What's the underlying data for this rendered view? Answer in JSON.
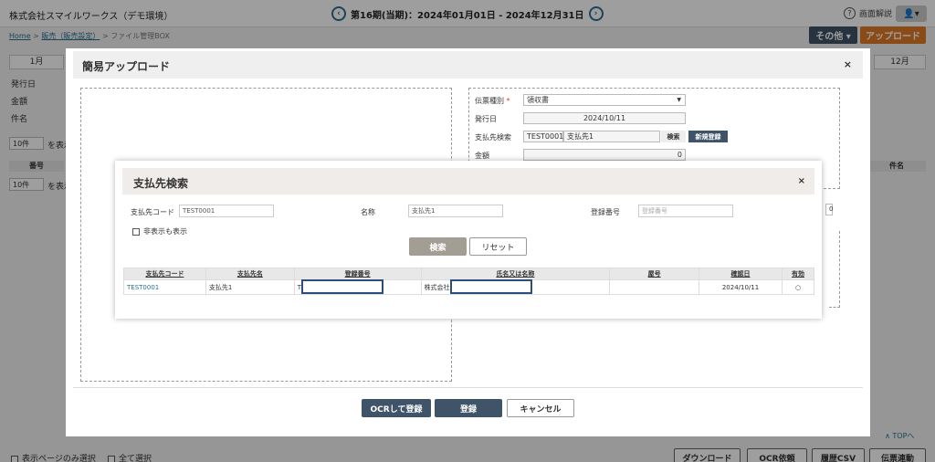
{
  "header": {
    "company": "株式会社スマイルワークス（デモ環境）",
    "period": "第16期(当期)：2024年01月01日 - 2024年12月31日",
    "prev_icon": "‹",
    "next_icon": "›",
    "help_label": "画面解説",
    "help_icon": "?",
    "user_icon": "👤▾"
  },
  "breadcrumb": {
    "home": "Home",
    "sep1": ">",
    "sales": "販売（販売設定）",
    "sep2": ">",
    "current": "ファイル管理BOX"
  },
  "actions": {
    "other": "その他 ▾",
    "upload": "アップロード"
  },
  "background": {
    "month_first": "1月",
    "month_last": "12月",
    "issue_date": "発行日",
    "amount": "金額",
    "subject": "件名",
    "per_page": "10件",
    "per_page_suffix": "を表示",
    "col_number": "番号",
    "col_subject": "件名",
    "select_page": "表示ページのみ選択",
    "select_all": "全て選択",
    "top_link": "∧ TOPへ",
    "download": "ダウンロード",
    "ocr_request": "OCR依頼",
    "history_csv": "履歴CSV",
    "voucher_link": "伝票連動",
    "partial_value": "0"
  },
  "upload_modal": {
    "title": "簡易アップロード",
    "close": "×",
    "voucher_type_label": "伝票種別",
    "required_mark": "*",
    "voucher_type_value": "領収書",
    "issue_date_label": "発行日",
    "issue_date_value": "2024/10/11",
    "vendor_search_label": "支払先検索",
    "vendor_code_value": "TEST0001",
    "vendor_name_value": "支払先1",
    "search_btn": "検索",
    "new_btn": "新規登録",
    "amount_label": "金額",
    "amount_value": "0",
    "ocr_register": "OCRして登録",
    "register": "登録",
    "cancel": "キャンセル"
  },
  "search_modal": {
    "title": "支払先検索",
    "close": "×",
    "code_label": "支払先コード",
    "code_value": "TEST0001",
    "name_label": "名称",
    "name_value": "支払先1",
    "reg_label": "登録番号",
    "reg_placeholder": "登録番号",
    "show_hidden": "非表示も表示",
    "search": "検索",
    "reset": "リセット",
    "columns": [
      "支払先コード",
      "支払先名",
      "登録番号",
      "氏名又は名称",
      "屋号",
      "確認日",
      "有効"
    ],
    "rows": [
      {
        "code": "TEST0001",
        "name": "支払先1",
        "reg_prefix": "T",
        "legal_name_prefix": "株式会社",
        "trade_name": "",
        "checked_date": "2024/10/11",
        "valid": "○"
      }
    ]
  }
}
